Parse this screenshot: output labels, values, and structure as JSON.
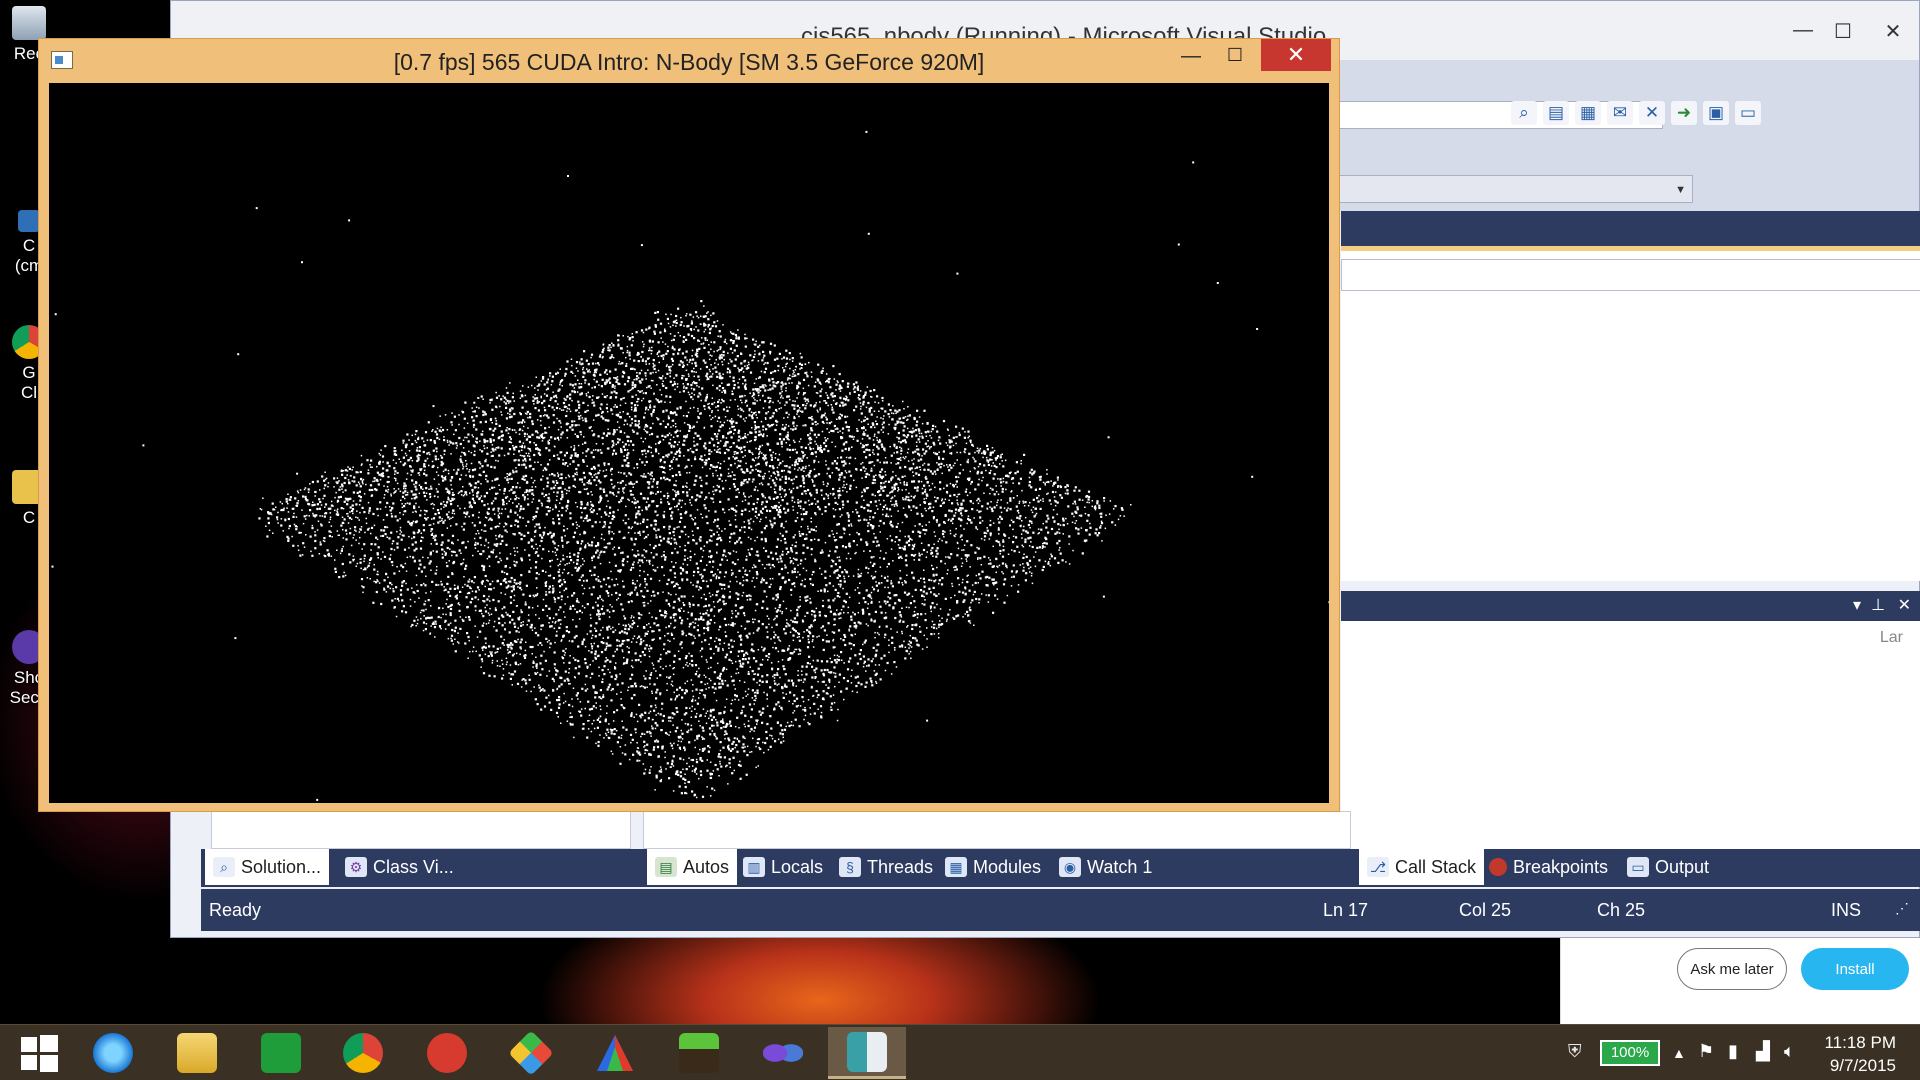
{
  "desktop": {
    "icons": [
      {
        "label": "Rec"
      },
      {
        "label": "C"
      },
      {
        "label": "(cm"
      },
      {
        "label": "G"
      },
      {
        "label": "Cl"
      },
      {
        "label": "C"
      },
      {
        "label": "Sho"
      },
      {
        "label": "Secu"
      }
    ]
  },
  "vs_window": {
    "title": "cis565_nbody (Running) - Microsoft Visual Studio",
    "right_column_header": "Lar",
    "status": {
      "ready": "Ready",
      "line": "Ln 17",
      "col": "Col 25",
      "ch": "Ch 25",
      "mode": "INS"
    },
    "tabs_left": [
      {
        "label": "Solution...",
        "icon": "solution-explorer-icon",
        "active": true
      },
      {
        "label": "Class Vi...",
        "icon": "class-view-icon",
        "active": false
      }
    ],
    "tabs_middle": [
      {
        "label": "Autos",
        "icon": "autos-icon",
        "active": true
      },
      {
        "label": "Locals",
        "icon": "locals-icon",
        "active": false
      },
      {
        "label": "Threads",
        "icon": "threads-icon",
        "active": false
      },
      {
        "label": "Modules",
        "icon": "modules-icon",
        "active": false
      },
      {
        "label": "Watch 1",
        "icon": "watch-icon",
        "active": false
      }
    ],
    "tabs_right": [
      {
        "label": "Call Stack",
        "icon": "call-stack-icon",
        "active": true
      },
      {
        "label": "Breakpoints",
        "icon": "breakpoints-icon",
        "active": false
      },
      {
        "label": "Output",
        "icon": "output-icon",
        "active": false
      }
    ]
  },
  "cuda_window": {
    "title": "[0.7 fps] 565 CUDA Intro: N-Body [SM 3.5 GeForce 920M]",
    "close_glyph": "✕",
    "min_glyph": "—",
    "max_glyph": "☐"
  },
  "notification": {
    "ask_later": "Ask me later",
    "install": "Install"
  },
  "taskbar": {
    "battery": "100%",
    "time": "11:18 PM",
    "date": "9/7/2015",
    "apps": [
      "start",
      "internet-explorer",
      "file-explorer",
      "store",
      "chrome",
      "mail",
      "git",
      "prism",
      "minecraft",
      "visual-studio",
      "nbody-window"
    ]
  },
  "colors": {
    "vs_dark_blue": "#2d3b61",
    "cuda_frame": "#f0c07a",
    "close_red": "#c7372f",
    "install_blue": "#27b6ef",
    "taskbar": "#3b3024"
  }
}
